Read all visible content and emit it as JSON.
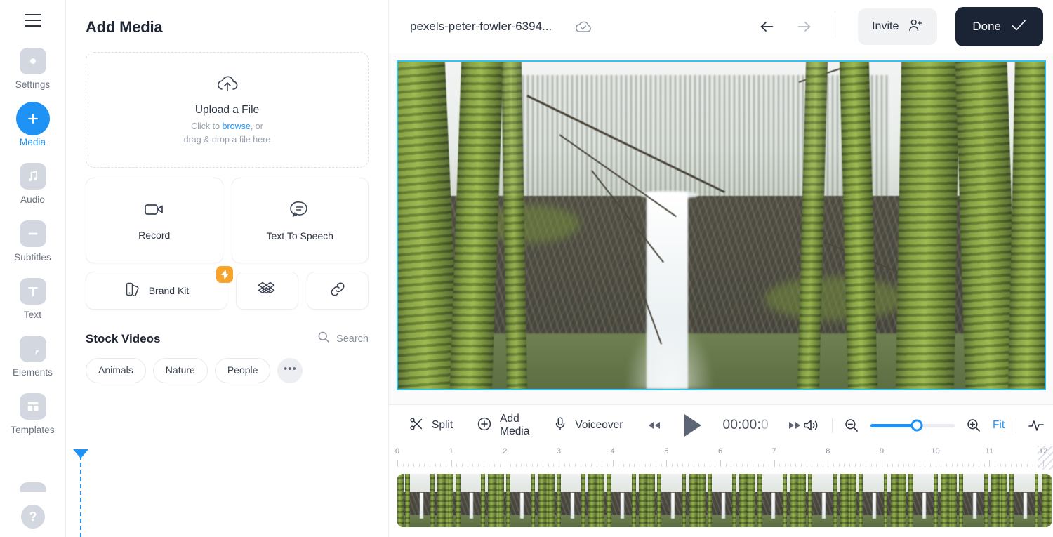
{
  "rail": {
    "menu_icon": "hamburger-icon",
    "items": [
      {
        "label": "Settings",
        "icon": "gear-icon",
        "active": false
      },
      {
        "label": "Media",
        "icon": "plus-circle-icon",
        "active": true
      },
      {
        "label": "Audio",
        "icon": "music-note-icon",
        "active": false
      },
      {
        "label": "Subtitles",
        "icon": "subtitles-icon",
        "active": false
      },
      {
        "label": "Text",
        "icon": "text-t-icon",
        "active": false
      },
      {
        "label": "Elements",
        "icon": "elements-shape-icon",
        "active": false
      },
      {
        "label": "Templates",
        "icon": "templates-layout-icon",
        "active": false
      }
    ],
    "help_label": "?",
    "help_icon": "question-mark-icon"
  },
  "panel": {
    "title": "Add Media",
    "dropzone": {
      "icon": "cloud-upload-icon",
      "title": "Upload a File",
      "sub_prefix": "Click to ",
      "sub_link": "browse",
      "sub_mid": ", or",
      "sub_line2": "drag & drop a file here"
    },
    "tiles": [
      {
        "label": "Record",
        "icon": "video-camera-icon"
      },
      {
        "label": "Text To Speech",
        "icon": "speech-bubble-icon"
      }
    ],
    "brand_kit": {
      "label": "Brand Kit",
      "icon": "color-swatch-icon",
      "badge_icon": "lightning-bolt-icon"
    },
    "dropbox": {
      "icon": "dropbox-icon"
    },
    "link": {
      "icon": "link-chain-icon"
    },
    "stock": {
      "title": "Stock Videos",
      "search_label": "Search",
      "search_icon": "search-icon",
      "chips": [
        "Animals",
        "Nature",
        "People"
      ],
      "more_label": "•••"
    }
  },
  "topbar": {
    "project_title": "pexels-peter-fowler-6394...",
    "cloud_icon": "cloud-check-icon",
    "undo_icon": "undo-arrow-icon",
    "redo_icon": "redo-arrow-icon",
    "invite_label": "Invite",
    "invite_icon": "person-add-icon",
    "done_label": "Done",
    "done_icon": "check-icon",
    "done_bg": "#1b2435",
    "accent": "#1e93f5"
  },
  "preview": {
    "border_color": "#2fc3f3",
    "selected": true
  },
  "timeline": {
    "tools": [
      {
        "label": "Split",
        "icon": "scissors-icon"
      },
      {
        "label": "Add Media",
        "icon": "plus-circle-icon"
      },
      {
        "label": "Voiceover",
        "icon": "microphone-icon"
      }
    ],
    "transport": {
      "prev_icon": "rewind-icon",
      "play_icon": "play-icon",
      "next_icon": "fast-forward-icon",
      "time": "00:00:0",
      "time_main": "00:00:",
      "time_dim": "0"
    },
    "right_controls": {
      "volume_icon": "volume-icon",
      "zoom_out_icon": "zoom-out-icon",
      "zoom_in_icon": "zoom-in-icon",
      "zoom_percent": 55,
      "fit_label": "Fit",
      "waveform_icon": "waveform-icon",
      "caption_icon": "caption-bubble-icon"
    },
    "ruler": {
      "labels": [
        "0",
        "1",
        "2",
        "3",
        "4",
        "5",
        "6",
        "7",
        "8",
        "9",
        "10",
        "11",
        "12"
      ],
      "max": 12,
      "minor_per_major": 10
    },
    "playhead": {
      "position": "0",
      "color": "#1e93f5"
    }
  }
}
